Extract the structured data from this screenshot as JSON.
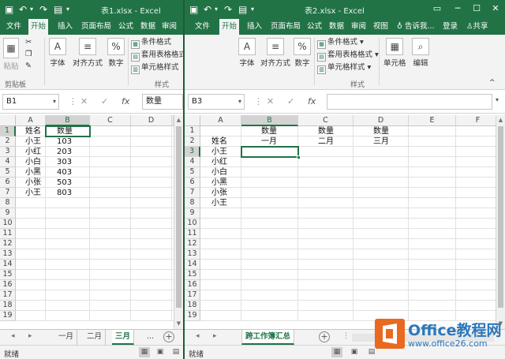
{
  "colors": {
    "excel_green": "#217346",
    "selection": "#217346",
    "watermark_blue": "#2d78b9",
    "watermark_orange": "#e8691f"
  },
  "left_window": {
    "title": "表1.xlsx - Excel",
    "menu": [
      "文件",
      "开始",
      "插入",
      "页面布局",
      "公式",
      "数据",
      "审阅"
    ],
    "active_menu_index": 1,
    "ribbon": {
      "paste": "粘贴",
      "clipboard_group": "剪贴板",
      "font": "字体",
      "alignment": "对齐方式",
      "number": "数字",
      "cond_format": "条件格式",
      "table_format": "套用表格格式",
      "cell_style": "单元格样式",
      "style_group": "样式"
    },
    "name_box": "B1",
    "formula_value": "数量",
    "columns": [
      "A",
      "B",
      "C",
      "D"
    ],
    "rows": [
      "1",
      "2",
      "3",
      "4",
      "5",
      "6",
      "7",
      "8",
      "9",
      "10",
      "11",
      "12",
      "13",
      "14",
      "15",
      "16",
      "17",
      "18",
      "19"
    ],
    "cells": {
      "A": [
        "姓名",
        "小王",
        "小红",
        "小白",
        "小黑",
        "小张",
        "小王"
      ],
      "B": [
        "数量",
        "103",
        "203",
        "303",
        "403",
        "503",
        "803"
      ]
    },
    "tabs": [
      "一月",
      "二月",
      "三月",
      "..."
    ],
    "active_tab_index": 2,
    "status": "就绪"
  },
  "right_window": {
    "title": "表2.xlsx - Excel",
    "menu": [
      "文件",
      "开始",
      "插入",
      "页面布局",
      "公式",
      "数据",
      "审阅",
      "视图"
    ],
    "active_menu_index": 1,
    "tell_me": "告诉我...",
    "login": "登录",
    "share": "共享",
    "ribbon": {
      "font": "字体",
      "alignment": "对齐方式",
      "number": "数字",
      "cond_format": "条件格式",
      "table_format": "套用表格格式",
      "cell_style": "单元格样式",
      "style_group": "样式",
      "cells": "单元格",
      "editing": "编辑"
    },
    "name_box": "B3",
    "formula_value": "",
    "columns": [
      "A",
      "B",
      "C",
      "D",
      "E",
      "F"
    ],
    "rows": [
      "1",
      "2",
      "3",
      "4",
      "5",
      "6",
      "7",
      "8",
      "9",
      "10",
      "11",
      "12",
      "13",
      "14",
      "15",
      "16",
      "17",
      "18",
      "19"
    ],
    "header_row1": [
      "数量",
      "数量",
      "数量"
    ],
    "header_row2": [
      "一月",
      "二月",
      "三月"
    ],
    "a_col_label": "姓名",
    "names": [
      "小王",
      "小红",
      "小白",
      "小黑",
      "小张",
      "小王"
    ],
    "tab": "跨工作簿汇总",
    "status": "就绪"
  },
  "watermark": {
    "brand": "Office教程网",
    "url": "www.office26.com"
  }
}
